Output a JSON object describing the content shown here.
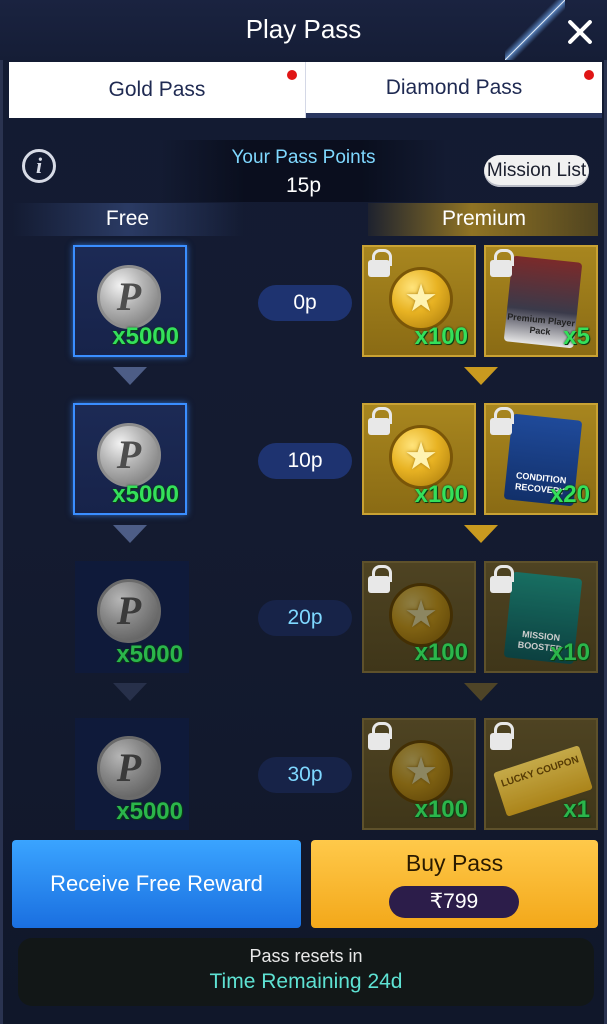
{
  "header": {
    "title": "Play Pass",
    "close_icon": "close-icon"
  },
  "tabs": [
    {
      "label": "Gold Pass",
      "has_notification": true,
      "selected": false
    },
    {
      "label": "Diamond Pass",
      "has_notification": true,
      "selected": true
    }
  ],
  "points": {
    "label": "Your Pass Points",
    "value": "15p",
    "info_icon": "info-icon",
    "mission_button": "Mission List"
  },
  "columns": {
    "free": "Free",
    "premium": "Premium"
  },
  "rows": [
    {
      "points": "0p",
      "free_qty": "x5000",
      "free_item": "pass-coin-icon",
      "premium": [
        {
          "item": "star-coin-icon",
          "qty": "x100"
        },
        {
          "item": "premium-player-pack-card",
          "qty": "x5",
          "caption": "Premium Player Pack"
        }
      ]
    },
    {
      "points": "10p",
      "free_qty": "x5000",
      "free_item": "pass-coin-icon",
      "premium": [
        {
          "item": "star-coin-icon",
          "qty": "x100"
        },
        {
          "item": "condition-recovery-card",
          "qty": "x20",
          "caption": "CONDITION RECOVERY"
        }
      ]
    },
    {
      "points": "20p",
      "free_qty": "x5000",
      "free_item": "pass-coin-icon",
      "premium": [
        {
          "item": "star-coin-icon",
          "qty": "x100"
        },
        {
          "item": "mission-booster-card",
          "qty": "x10",
          "caption": "MISSION BOOSTER"
        }
      ]
    },
    {
      "points": "30p",
      "free_qty": "x5000",
      "free_item": "pass-coin-icon",
      "premium": [
        {
          "item": "star-coin-icon",
          "qty": "x100"
        },
        {
          "item": "lucky-coupon-ticket",
          "qty": "x1",
          "caption": "LUCKY COUPON"
        }
      ]
    }
  ],
  "actions": {
    "receive_free": "Receive Free Reward",
    "buy_pass": "Buy Pass",
    "price": "₹799"
  },
  "footer": {
    "line1": "Pass resets in",
    "line2": "Time Remaining 24d"
  },
  "colors": {
    "accent_blue": "#1a6fe0",
    "accent_gold": "#f3a81a",
    "qty_green": "#34e05a",
    "points_cyan": "#7fd8ff",
    "timer_teal": "#5ee2d3",
    "notification_red": "#e01515"
  }
}
